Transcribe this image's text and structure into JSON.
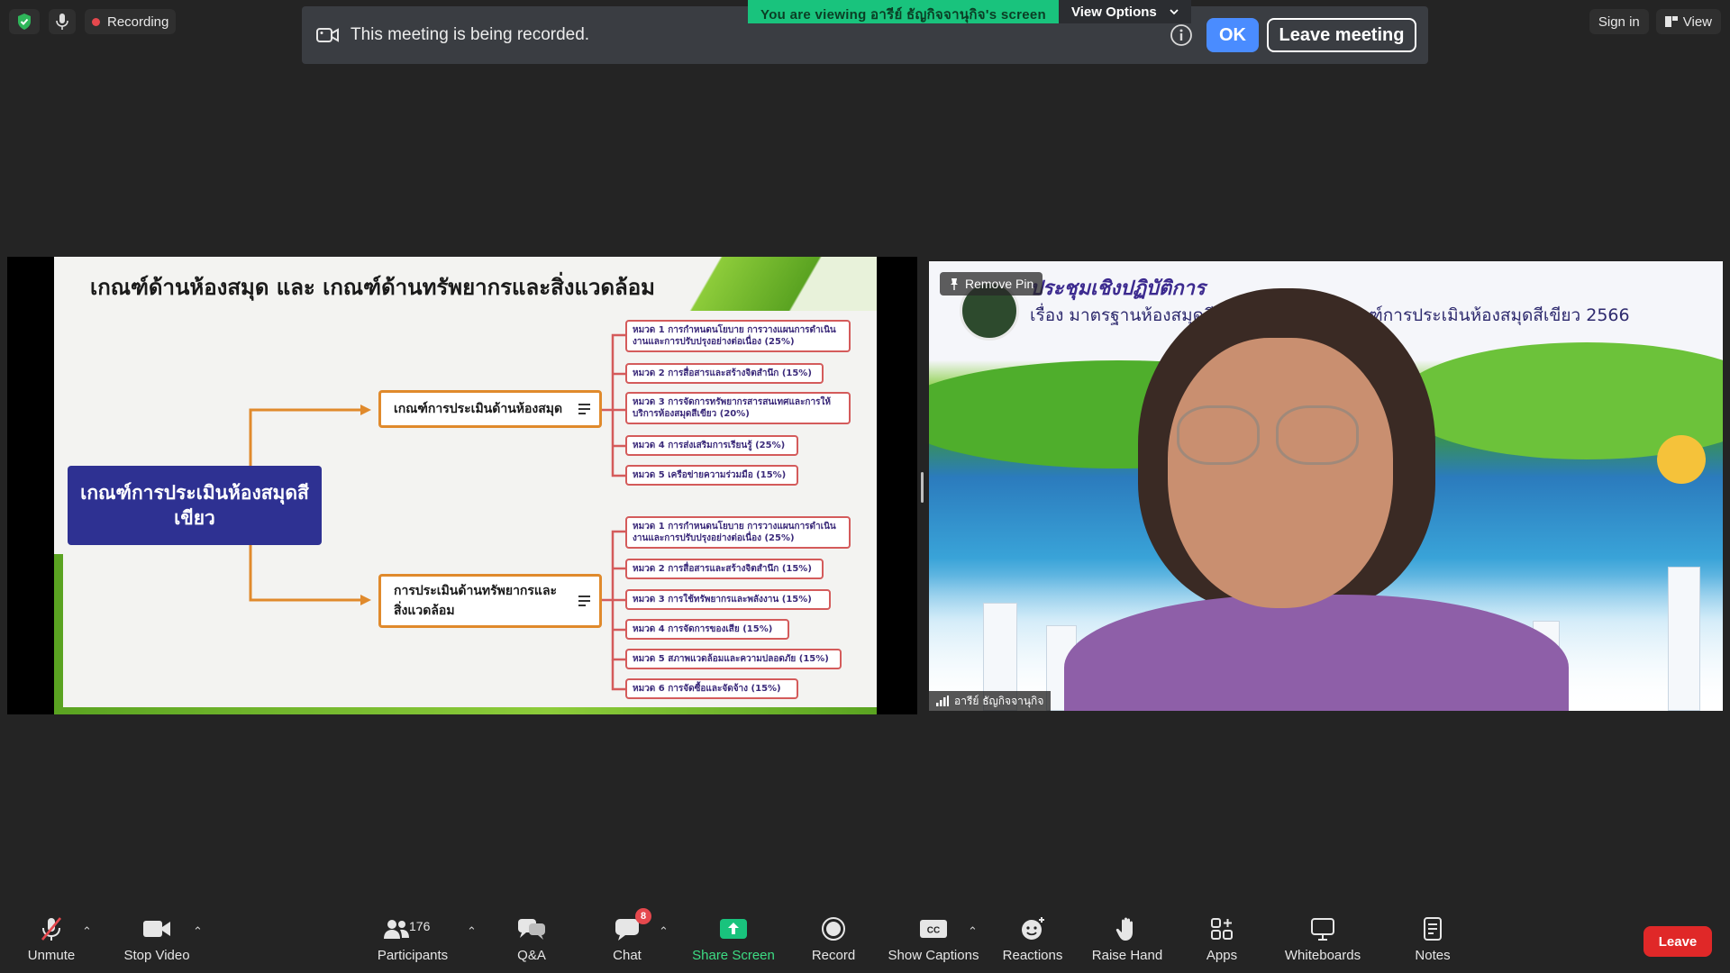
{
  "topbar": {
    "recording_label": "Recording",
    "sign_in_label": "Sign in",
    "view_label": "View"
  },
  "banner": {
    "message": "This meeting is being recorded.",
    "ok_label": "OK",
    "leave_meeting_label": "Leave meeting",
    "viewing_text": "You are viewing อารีย์ ธัญกิจจานุกิจ's screen",
    "view_options_label": "View Options"
  },
  "slide": {
    "title": "เกณฑ์ด้านห้องสมุด และ เกณฑ์ด้านทรัพยากรและสิ่งแวดล้อม",
    "root": "เกณฑ์การประเมินห้องสมุดสีเขียว",
    "branch_library": {
      "label": "เกณฑ์การประเมินด้านห้องสมุด",
      "items": [
        "หมวด 1 การกำหนดนโยบาย การวางแผนการดำเนินงานและการปรับปรุงอย่างต่อเนื่อง (25%)",
        "หมวด 2 การสื่อสารและสร้างจิตสำนึก (15%)",
        "หมวด 3 การจัดการทรัพยากรสารสนเทศและการให้บริการห้องสมุดสีเขียว (20%)",
        "หมวด 4 การส่งเสริมการเรียนรู้ (25%)",
        "หมวด 5 เครือข่ายความร่วมมือ (15%)"
      ]
    },
    "branch_env": {
      "label": "การประเมินด้านทรัพยากรและสิ่งแวดล้อม",
      "items": [
        "หมวด 1 การกำหนดนโยบาย การวางแผนการดำเนินงานและการปรับปรุงอย่างต่อเนื่อง (25%)",
        "หมวด 2 การสื่อสารและสร้างจิตสำนึก (15%)",
        "หมวด 3 การใช้ทรัพยากรและพลังงาน (15%)",
        "หมวด 4 การจัดการของเสีย (15%)",
        "หมวด 5 สภาพแวดล้อมและความปลอดภัย (15%)",
        "หมวด 6 การจัดซื้อและจัดจ้าง (15%)"
      ]
    }
  },
  "video": {
    "banner_title": "ประชุมเชิงปฏิบัติการ",
    "banner_subtitle": "เรื่อง มาตรฐานห้องสมุดสีเขียว 2566 และเกณฑ์การประเมินห้องสมุดสีเขียว 2566",
    "pin_label": "Remove Pin",
    "participant_name": "อารีย์ ธัญกิจจานุกิจ"
  },
  "toolbar": {
    "unmute": "Unmute",
    "stop_video": "Stop Video",
    "participants": "Participants",
    "participant_count": "176",
    "qa": "Q&A",
    "chat": "Chat",
    "chat_badge": "8",
    "share_screen": "Share Screen",
    "record": "Record",
    "show_captions": "Show Captions",
    "reactions": "Reactions",
    "raise_hand": "Raise Hand",
    "apps": "Apps",
    "whiteboards": "Whiteboards",
    "notes": "Notes",
    "leave": "Leave"
  },
  "colors": {
    "accent_blue": "#4a8cff",
    "green_share": "#19c37d",
    "danger_red": "#e02828",
    "slide_navy": "#2e3192",
    "slide_orange": "#e08a2c"
  }
}
